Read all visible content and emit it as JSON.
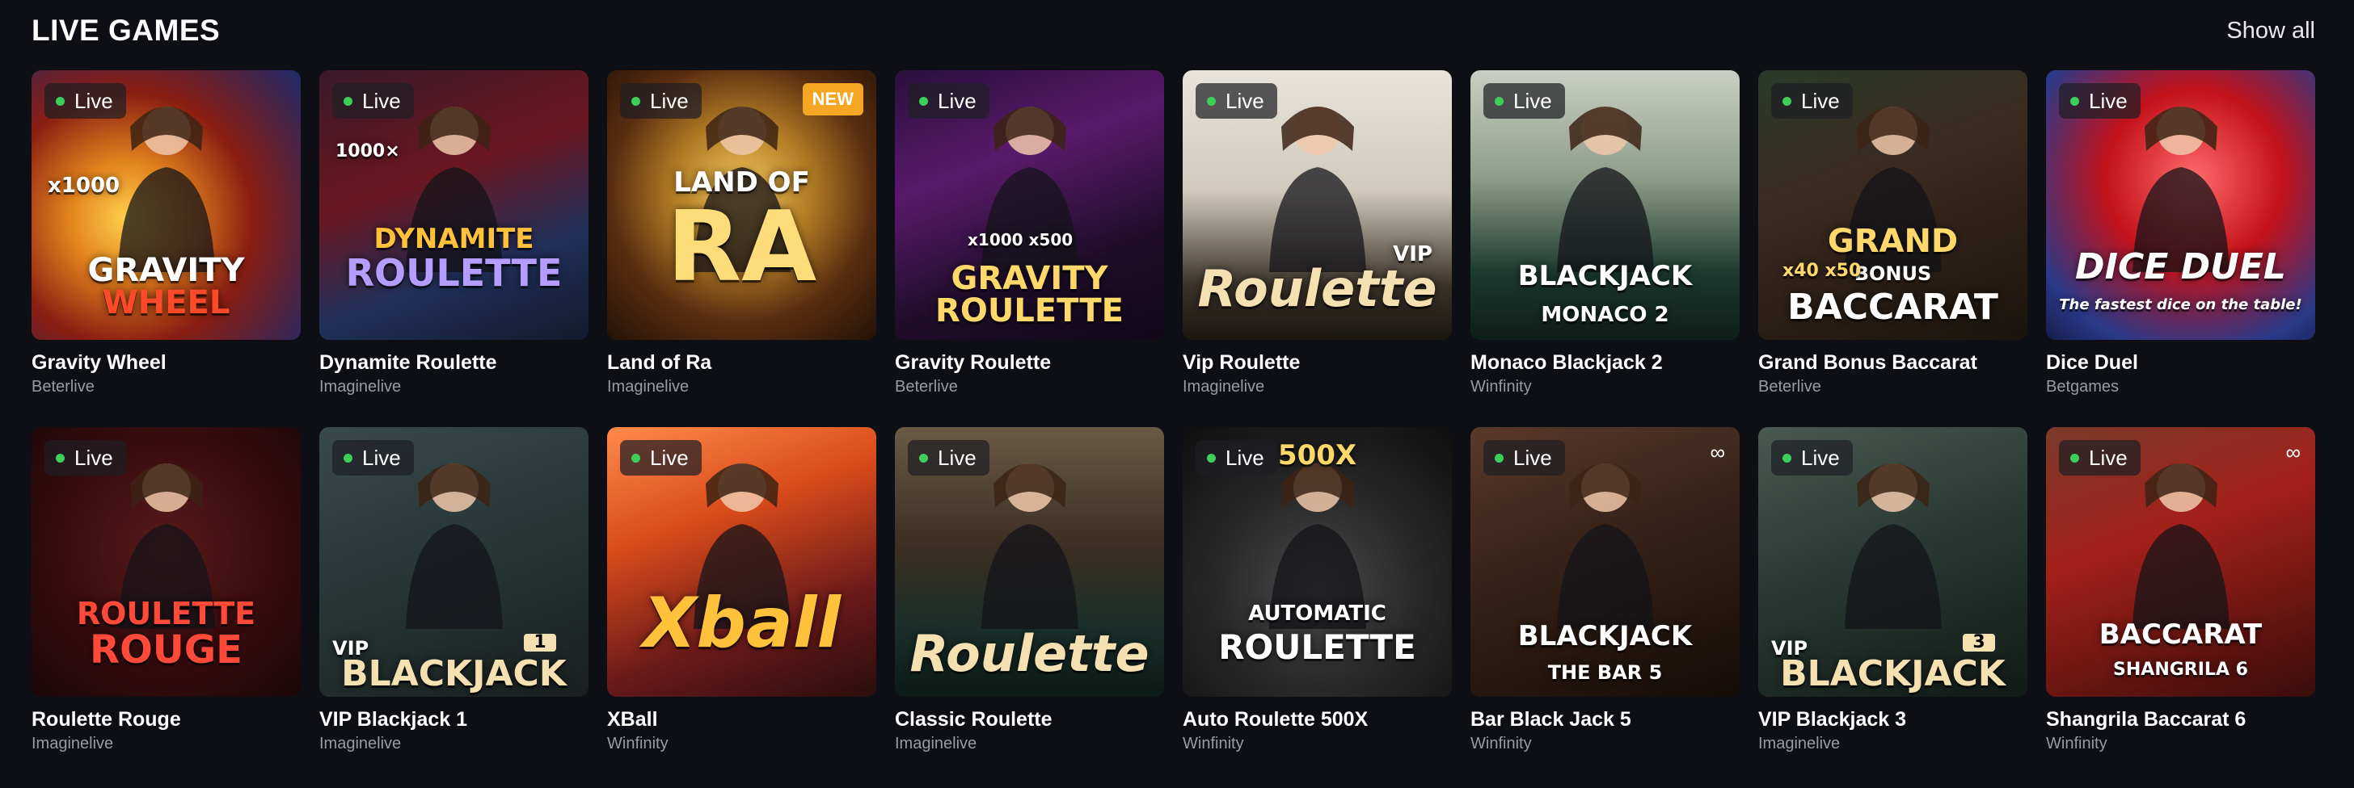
{
  "section": {
    "title": "LIVE GAMES",
    "show_all": "Show all"
  },
  "badges": {
    "live": "Live",
    "new": "NEW",
    "brand_icon": "infinity-icon"
  },
  "games": [
    {
      "name": "Gravity Wheel",
      "provider": "Beterlive",
      "art": [
        "GRAVITY",
        "WHEEL"
      ],
      "multiplier": "x1000",
      "new": false,
      "brand": false
    },
    {
      "name": "Dynamite Roulette",
      "provider": "Imaginelive",
      "art": [
        "DYNAMITE",
        "ROULETTE"
      ],
      "multiplier": "1000×",
      "new": false,
      "brand": false
    },
    {
      "name": "Land of Ra",
      "provider": "Imaginelive",
      "art": [
        "LAND OF",
        "RA"
      ],
      "multiplier": "",
      "new": true,
      "brand": false
    },
    {
      "name": "Gravity Roulette",
      "provider": "Beterlive",
      "art": [
        "GRAVITY",
        "ROULETTE"
      ],
      "multiplier": "x1000 x500",
      "new": false,
      "brand": false
    },
    {
      "name": "Vip Roulette",
      "provider": "Imaginelive",
      "art": [
        "VIP",
        "Roulette"
      ],
      "multiplier": "",
      "new": false,
      "brand": false
    },
    {
      "name": "Monaco Blackjack 2",
      "provider": "Winfinity",
      "art": [
        "BLACKJACK",
        "MONACO 2"
      ],
      "multiplier": "",
      "new": false,
      "brand": false
    },
    {
      "name": "Grand Bonus Baccarat",
      "provider": "Beterlive",
      "art": [
        "GRAND",
        "BONUS",
        "BACCARAT"
      ],
      "multiplier": "x40 x50",
      "new": false,
      "brand": false
    },
    {
      "name": "Dice Duel",
      "provider": "Betgames",
      "art": [
        "DICE DUEL",
        "The fastest dice on the table!"
      ],
      "multiplier": "",
      "new": false,
      "brand": false
    },
    {
      "name": "Roulette Rouge",
      "provider": "Imaginelive",
      "art": [
        "ROULETTE",
        "ROUGE"
      ],
      "multiplier": "",
      "new": false,
      "brand": false
    },
    {
      "name": "VIP Blackjack 1",
      "provider": "Imaginelive",
      "art": [
        "VIP",
        "BLACKJACK",
        "1"
      ],
      "multiplier": "",
      "new": false,
      "brand": false
    },
    {
      "name": "XBall",
      "provider": "Winfinity",
      "art": [
        "Xball"
      ],
      "multiplier": "",
      "new": false,
      "brand": false
    },
    {
      "name": "Classic Roulette",
      "provider": "Imaginelive",
      "art": [
        "Roulette"
      ],
      "multiplier": "",
      "new": false,
      "brand": false
    },
    {
      "name": "Auto Roulette 500X",
      "provider": "Winfinity",
      "art": [
        "500X",
        "AUTOMATIC",
        "ROULETTE"
      ],
      "multiplier": "",
      "new": false,
      "brand": false
    },
    {
      "name": "Bar Black Jack 5",
      "provider": "Winfinity",
      "art": [
        "BLACKJACK",
        "THE BAR 5"
      ],
      "multiplier": "",
      "new": false,
      "brand": true
    },
    {
      "name": "VIP Blackjack 3",
      "provider": "Imaginelive",
      "art": [
        "VIP",
        "BLACKJACK",
        "3"
      ],
      "multiplier": "",
      "new": false,
      "brand": false
    },
    {
      "name": "Shangrila Baccarat 6",
      "provider": "Winfinity",
      "art": [
        "BACCARAT",
        "SHANGRILA 6"
      ],
      "multiplier": "",
      "new": false,
      "brand": true
    }
  ]
}
